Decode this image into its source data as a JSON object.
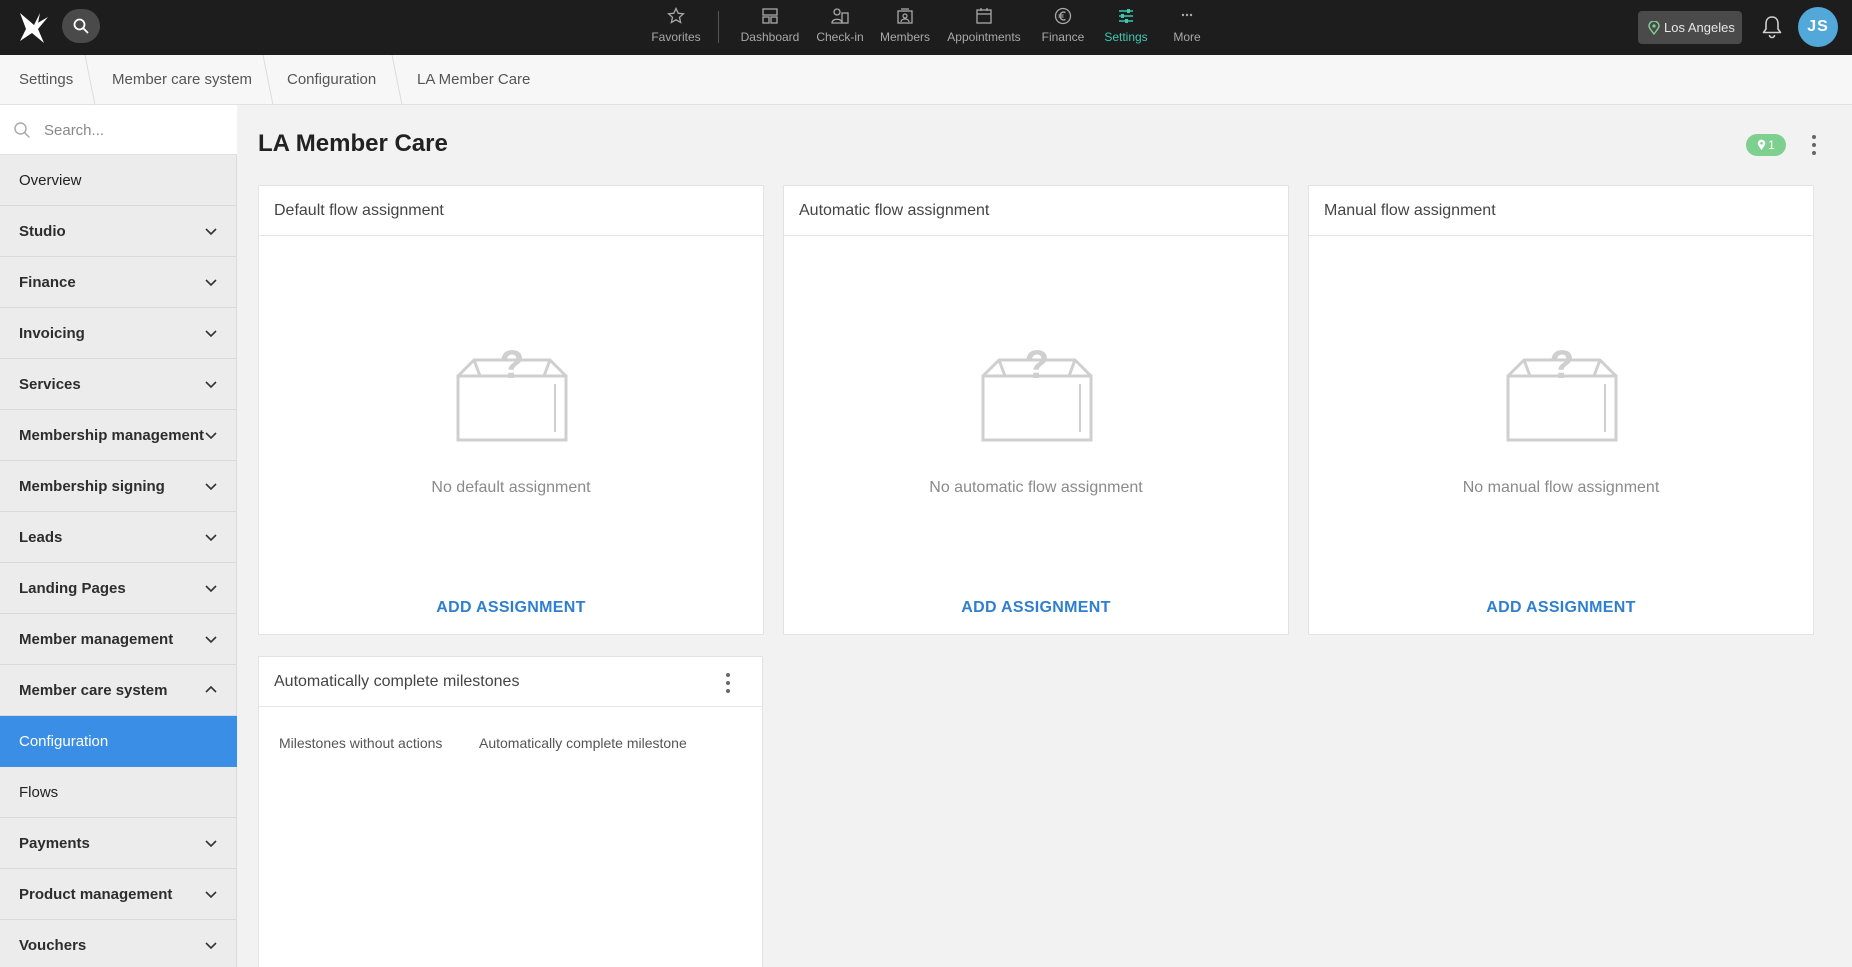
{
  "topbar": {
    "nav": [
      {
        "label": "Favorites",
        "icon": "star-icon"
      },
      {
        "label": "Dashboard",
        "icon": "dashboard-icon"
      },
      {
        "label": "Check-in",
        "icon": "check-in-icon"
      },
      {
        "label": "Members",
        "icon": "members-icon"
      },
      {
        "label": "Appointments",
        "icon": "calendar-icon"
      },
      {
        "label": "Finance",
        "icon": "euro-icon"
      },
      {
        "label": "Settings",
        "icon": "sliders-icon",
        "active": true
      },
      {
        "label": "More",
        "icon": "more-icon"
      }
    ],
    "location": "Los Angeles",
    "avatar_initials": "JS",
    "colors": {
      "bar": "#1d1d1d",
      "active": "#3fc7b0",
      "avatar": "#52a8d9"
    }
  },
  "breadcrumb": [
    "Settings",
    "Member care system",
    "Configuration",
    "LA Member Care"
  ],
  "sidebar": {
    "search_placeholder": "Search...",
    "items": [
      {
        "label": "Overview",
        "expandable": false
      },
      {
        "label": "Studio",
        "expandable": true
      },
      {
        "label": "Finance",
        "expandable": true
      },
      {
        "label": "Invoicing",
        "expandable": true
      },
      {
        "label": "Services",
        "expandable": true
      },
      {
        "label": "Membership management",
        "expandable": true
      },
      {
        "label": "Membership signing",
        "expandable": true
      },
      {
        "label": "Leads",
        "expandable": true
      },
      {
        "label": "Landing Pages",
        "expandable": true
      },
      {
        "label": "Member management",
        "expandable": true
      },
      {
        "label": "Member care system",
        "expandable": true,
        "expanded": true
      },
      {
        "label": "Configuration",
        "sub": true,
        "active": true
      },
      {
        "label": "Flows",
        "sub": true
      },
      {
        "label": "Payments",
        "expandable": true
      },
      {
        "label": "Product management",
        "expandable": true
      },
      {
        "label": "Vouchers",
        "expandable": true
      }
    ],
    "active_color": "#3a8ee6"
  },
  "main": {
    "title": "LA Member Care",
    "location_badge_count": "1",
    "cards": [
      {
        "title": "Default flow assignment",
        "empty_text": "No default assignment",
        "action": "ADD ASSIGNMENT"
      },
      {
        "title": "Automatic flow assignment",
        "empty_text": "No automatic flow assignment",
        "action": "ADD ASSIGNMENT"
      },
      {
        "title": "Manual flow assignment",
        "empty_text": "No manual flow assignment",
        "action": "ADD ASSIGNMENT"
      }
    ],
    "milestones": {
      "title": "Automatically complete milestones",
      "columns": [
        "Milestones without actions",
        "Automatically complete milestone"
      ]
    },
    "link_color": "#2f7fd0"
  }
}
